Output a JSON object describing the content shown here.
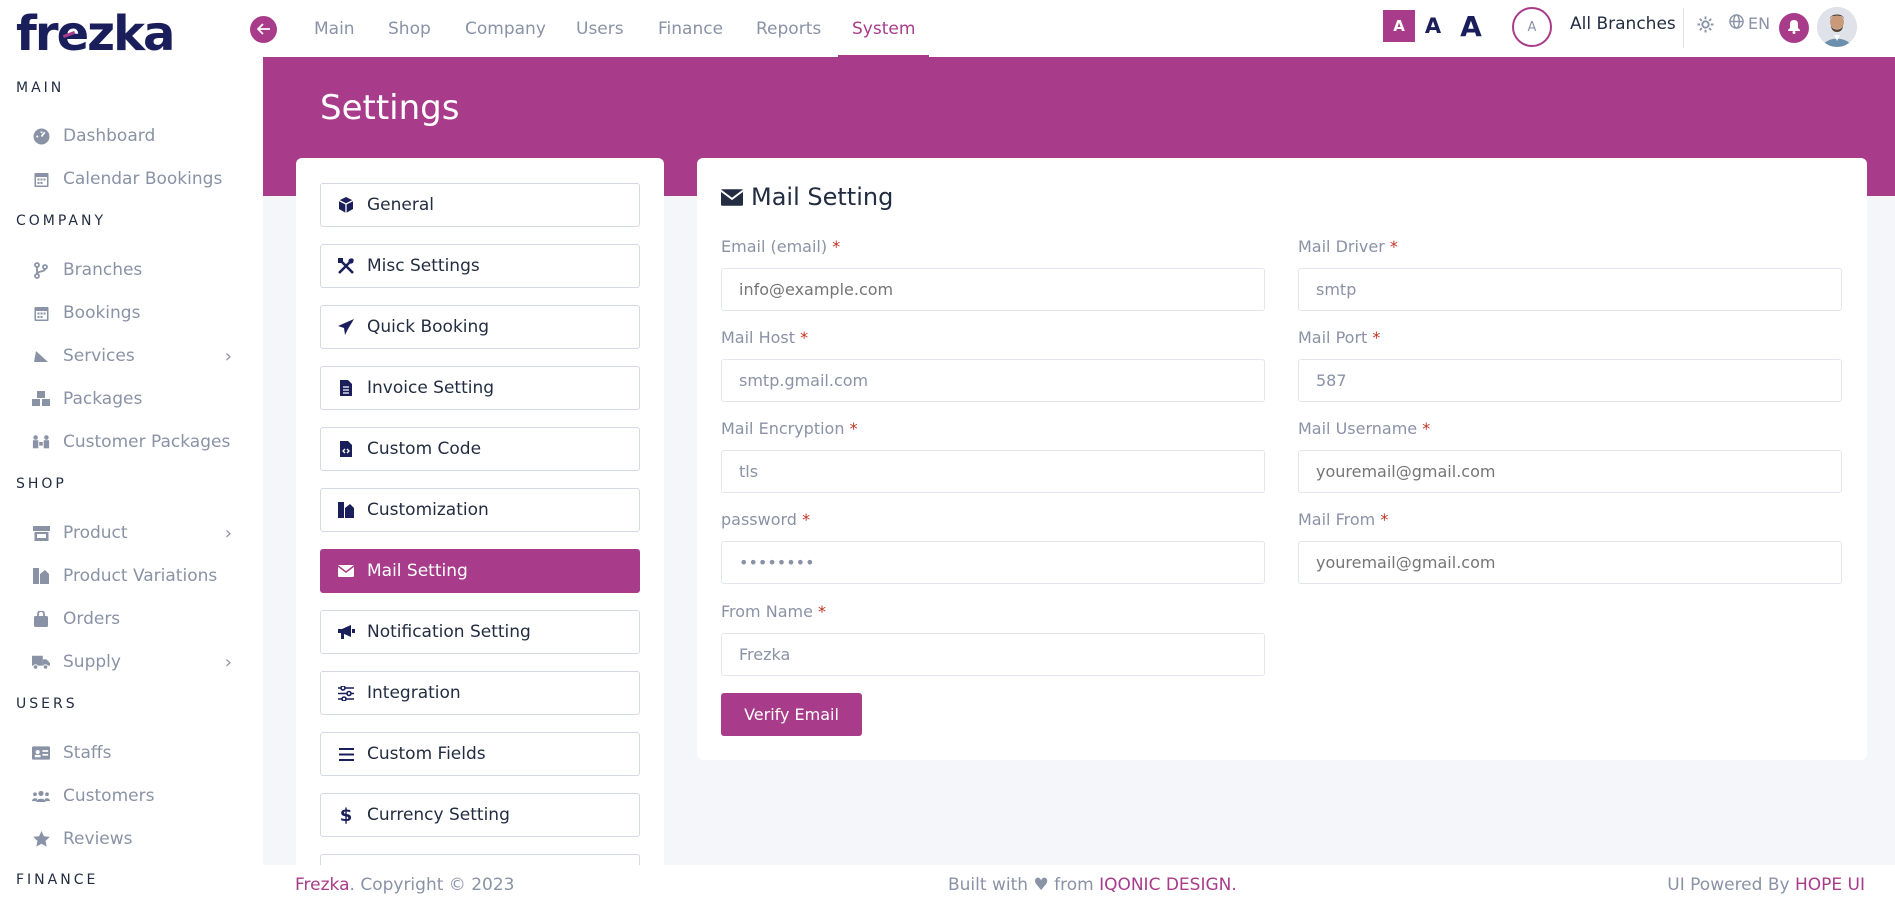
{
  "app": {
    "logo_text": "frezka"
  },
  "sidebar": {
    "sections": [
      {
        "title": "MAIN"
      },
      {
        "title": "COMPANY"
      },
      {
        "title": "SHOP"
      },
      {
        "title": "USERS"
      },
      {
        "title": "FINANCE"
      }
    ],
    "items": [
      {
        "label": "Dashboard",
        "icon": "dashboard-icon"
      },
      {
        "label": "Calendar Bookings",
        "icon": "calendar-icon"
      },
      {
        "label": "Branches",
        "icon": "branch-icon"
      },
      {
        "label": "Bookings",
        "icon": "calendar-icon"
      },
      {
        "label": "Services",
        "icon": "services-icon"
      },
      {
        "label": "Packages",
        "icon": "packages-icon"
      },
      {
        "label": "Customer Packages",
        "icon": "customer-packages-icon"
      },
      {
        "label": "Product",
        "icon": "store-icon"
      },
      {
        "label": "Product Variations",
        "icon": "variations-icon"
      },
      {
        "label": "Orders",
        "icon": "bag-icon"
      },
      {
        "label": "Supply",
        "icon": "truck-icon"
      },
      {
        "label": "Staffs",
        "icon": "id-card-icon"
      },
      {
        "label": "Customers",
        "icon": "users-icon"
      },
      {
        "label": "Reviews",
        "icon": "star-icon"
      }
    ]
  },
  "topnav": {
    "items": [
      "Main",
      "Shop",
      "Company",
      "Users",
      "Finance",
      "Reports",
      "System"
    ],
    "active": "System",
    "font_sizes": [
      "A",
      "A",
      "A"
    ],
    "avatar_letter": "A",
    "branch_label": "All Branches",
    "language": "EN"
  },
  "page": {
    "title": "Settings"
  },
  "settings_menu": [
    {
      "label": "General",
      "icon": "cube-icon"
    },
    {
      "label": "Misc Settings",
      "icon": "tools-icon"
    },
    {
      "label": "Quick Booking",
      "icon": "paper-plane-icon"
    },
    {
      "label": "Invoice Setting",
      "icon": "file-icon"
    },
    {
      "label": "Custom Code",
      "icon": "file-code-icon"
    },
    {
      "label": "Customization",
      "icon": "customization-icon"
    },
    {
      "label": "Mail Setting",
      "icon": "envelope-icon"
    },
    {
      "label": "Notification Setting",
      "icon": "megaphone-icon"
    },
    {
      "label": "Integration",
      "icon": "sliders-icon"
    },
    {
      "label": "Custom Fields",
      "icon": "list-icon"
    },
    {
      "label": "Currency Setting",
      "icon": "dollar-icon"
    }
  ],
  "mail": {
    "title": "Mail Setting",
    "fields": {
      "email": {
        "label": "Email (email)",
        "placeholder": "info@example.com",
        "value": ""
      },
      "driver": {
        "label": "Mail Driver",
        "value": "smtp"
      },
      "host": {
        "label": "Mail Host",
        "value": "smtp.gmail.com"
      },
      "port": {
        "label": "Mail Port",
        "value": "587"
      },
      "encryption": {
        "label": "Mail Encryption",
        "value": "tls"
      },
      "username": {
        "label": "Mail Username",
        "placeholder": "youremail@gmail.com",
        "value": ""
      },
      "password": {
        "label": "password",
        "value": "password"
      },
      "from": {
        "label": "Mail From",
        "placeholder": "youremail@gmail.com",
        "value": ""
      },
      "from_name": {
        "label": "From Name",
        "value": "Frezka"
      }
    },
    "required_mark": "*",
    "verify_label": "Verify Email"
  },
  "footer": {
    "brand": "Frezka",
    "copyright": ". Copyright © 2023",
    "built_with": "Built with",
    "heart": "♥",
    "from": "from",
    "company": "IQONIC DESIGN.",
    "powered": "UI Powered By",
    "powered_brand": "HOPE UI"
  },
  "colors": {
    "accent": "#a83c8a",
    "navy": "#1a1f5c",
    "muted": "#8a92a6"
  }
}
